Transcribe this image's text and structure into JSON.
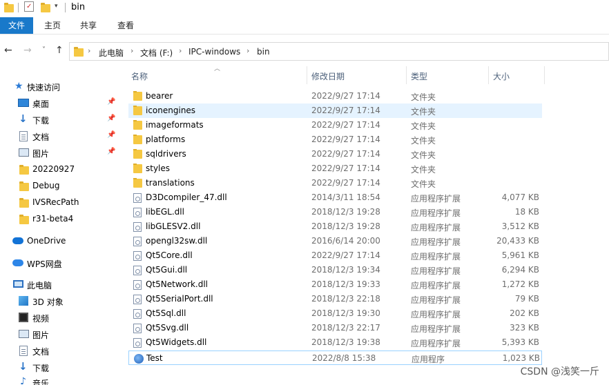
{
  "window": {
    "title": "bin"
  },
  "ribbon": {
    "tabs": [
      "文件",
      "主页",
      "共享",
      "查看"
    ]
  },
  "address": {
    "crumbs": [
      "此电脑",
      "文档 (F:)",
      "IPC-windows",
      "bin"
    ]
  },
  "sidebar": {
    "quick_access": "快速访问",
    "pinned": [
      "桌面",
      "下载",
      "文档",
      "图片"
    ],
    "recent": [
      "20220927",
      "Debug",
      "IVSRecPath",
      "r31-beta4"
    ],
    "onedrive": "OneDrive",
    "wps": "WPS网盘",
    "this_pc": "此电脑",
    "pc_items": [
      "3D 对象",
      "视频",
      "图片",
      "文档",
      "下载",
      "音乐"
    ]
  },
  "columns": {
    "name": "名称",
    "date": "修改日期",
    "type": "类型",
    "size": "大小"
  },
  "files": [
    {
      "name": "bearer",
      "date": "2022/9/27 17:14",
      "type": "文件夹",
      "size": "",
      "icon": "folder"
    },
    {
      "name": "iconengines",
      "date": "2022/9/27 17:14",
      "type": "文件夹",
      "size": "",
      "icon": "folder"
    },
    {
      "name": "imageformats",
      "date": "2022/9/27 17:14",
      "type": "文件夹",
      "size": "",
      "icon": "folder"
    },
    {
      "name": "platforms",
      "date": "2022/9/27 17:14",
      "type": "文件夹",
      "size": "",
      "icon": "folder"
    },
    {
      "name": "sqldrivers",
      "date": "2022/9/27 17:14",
      "type": "文件夹",
      "size": "",
      "icon": "folder"
    },
    {
      "name": "styles",
      "date": "2022/9/27 17:14",
      "type": "文件夹",
      "size": "",
      "icon": "folder"
    },
    {
      "name": "translations",
      "date": "2022/9/27 17:14",
      "type": "文件夹",
      "size": "",
      "icon": "folder"
    },
    {
      "name": "D3Dcompiler_47.dll",
      "date": "2014/3/11 18:54",
      "type": "应用程序扩展",
      "size": "4,077 KB",
      "icon": "dll"
    },
    {
      "name": "libEGL.dll",
      "date": "2018/12/3 19:28",
      "type": "应用程序扩展",
      "size": "18 KB",
      "icon": "dll"
    },
    {
      "name": "libGLESV2.dll",
      "date": "2018/12/3 19:28",
      "type": "应用程序扩展",
      "size": "3,512 KB",
      "icon": "dll"
    },
    {
      "name": "opengl32sw.dll",
      "date": "2016/6/14 20:00",
      "type": "应用程序扩展",
      "size": "20,433 KB",
      "icon": "dll"
    },
    {
      "name": "Qt5Core.dll",
      "date": "2022/9/27 17:14",
      "type": "应用程序扩展",
      "size": "5,961 KB",
      "icon": "dll"
    },
    {
      "name": "Qt5Gui.dll",
      "date": "2018/12/3 19:34",
      "type": "应用程序扩展",
      "size": "6,294 KB",
      "icon": "dll"
    },
    {
      "name": "Qt5Network.dll",
      "date": "2018/12/3 19:33",
      "type": "应用程序扩展",
      "size": "1,272 KB",
      "icon": "dll"
    },
    {
      "name": "Qt5SerialPort.dll",
      "date": "2018/12/3 22:18",
      "type": "应用程序扩展",
      "size": "79 KB",
      "icon": "dll"
    },
    {
      "name": "Qt5Sql.dll",
      "date": "2018/12/3 19:30",
      "type": "应用程序扩展",
      "size": "202 KB",
      "icon": "dll"
    },
    {
      "name": "Qt5Svg.dll",
      "date": "2018/12/3 22:17",
      "type": "应用程序扩展",
      "size": "323 KB",
      "icon": "dll"
    },
    {
      "name": "Qt5Widgets.dll",
      "date": "2018/12/3 19:38",
      "type": "应用程序扩展",
      "size": "5,393 KB",
      "icon": "dll"
    },
    {
      "name": "Test",
      "date": "2022/8/8 15:38",
      "type": "应用程序",
      "size": "1,023 KB",
      "icon": "exe"
    }
  ],
  "watermark": "CSDN @浅笑一斤",
  "colors": {
    "accent": "#1979ca",
    "hover": "#e5f3ff",
    "selected_border": "#99d1ff",
    "folder": "#f5c842"
  }
}
